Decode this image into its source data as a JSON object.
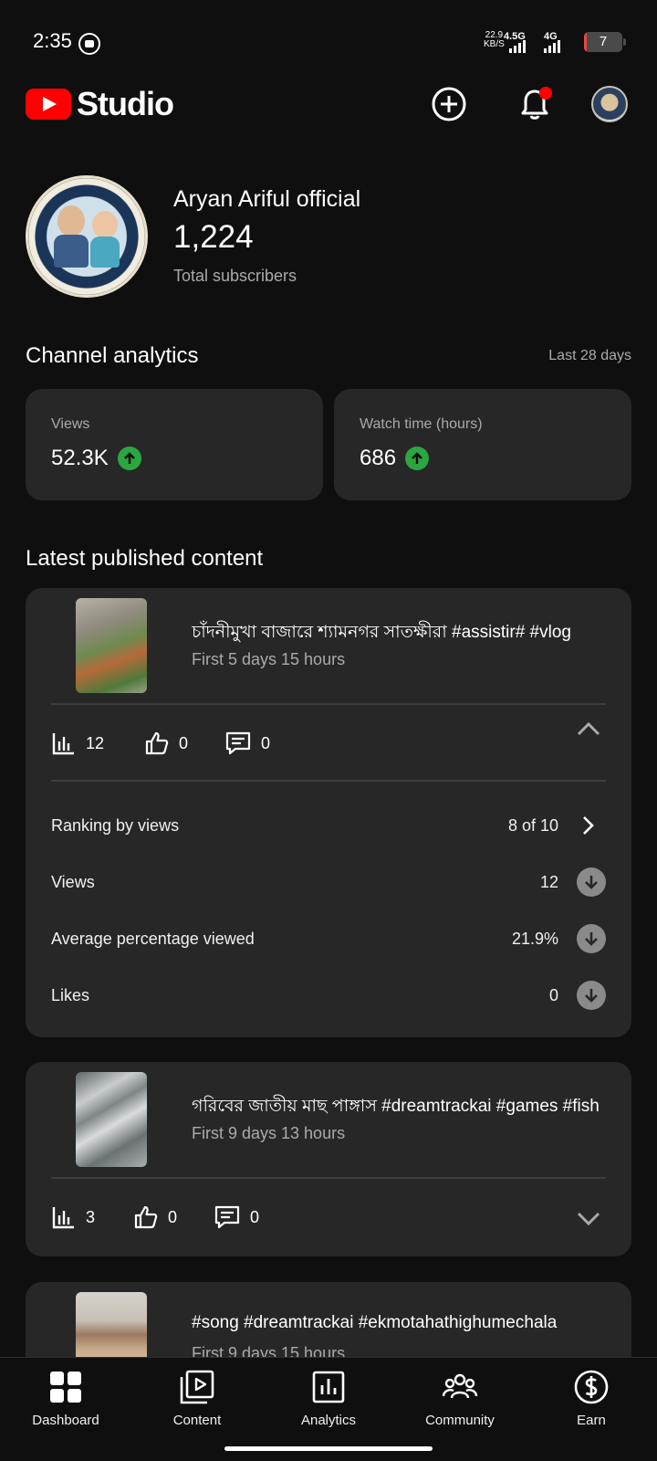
{
  "status_bar": {
    "time": "2:35",
    "net_speed_value": "22.9",
    "net_speed_unit": "KB/S",
    "signal1": "4.5G",
    "signal2": "4G",
    "battery": "7",
    "battery_level_pct": 7
  },
  "header": {
    "logo_text": "Studio",
    "brand_color": "#ff0000",
    "icons": [
      "create-icon",
      "notifications-icon",
      "account-avatar"
    ]
  },
  "channel": {
    "name": "Aryan Ariful official",
    "subscribers": "1,224",
    "subscribers_label": "Total subscribers"
  },
  "analytics": {
    "title": "Channel analytics",
    "range": "Last 28 days",
    "cards": [
      {
        "label": "Views",
        "value": "52.3K",
        "trend": "up"
      },
      {
        "label": "Watch time (hours)",
        "value": "686",
        "trend": "up"
      }
    ],
    "trend_color": "#2ba640"
  },
  "latest": {
    "title": "Latest published content",
    "items": [
      {
        "title": "চাঁদনীমুখা বাজারে শ্যামনগর সাতক্ষীরা #assistir# #vlog",
        "meta": "First 5 days 15 hours",
        "views": "12",
        "likes": "0",
        "comments": "0",
        "expanded": true,
        "details": [
          {
            "label": "Ranking by views",
            "value": "8 of 10",
            "icon": "chevron-right-icon"
          },
          {
            "label": "Views",
            "value": "12",
            "icon": "arrow-down-icon"
          },
          {
            "label": "Average percentage viewed",
            "value": "21.9%",
            "icon": "arrow-down-icon"
          },
          {
            "label": "Likes",
            "value": "0",
            "icon": "arrow-down-icon"
          }
        ]
      },
      {
        "title": "গরিবের জাতীয় মাছ পাঙ্গাস #dreamtrackai #games #fish",
        "meta": "First 9 days 13 hours",
        "views": "3",
        "likes": "0",
        "comments": "0",
        "expanded": false
      },
      {
        "title": "#song #dreamtrackai #ekmotahathighumechala",
        "meta": "First 9 days 15 hours"
      }
    ]
  },
  "bottom_nav": {
    "items": [
      {
        "label": "Dashboard",
        "icon": "dashboard-icon",
        "active": true
      },
      {
        "label": "Content",
        "icon": "content-icon",
        "active": false
      },
      {
        "label": "Analytics",
        "icon": "analytics-icon",
        "active": false
      },
      {
        "label": "Community",
        "icon": "community-icon",
        "active": false
      },
      {
        "label": "Earn",
        "icon": "earn-icon",
        "active": false
      }
    ]
  }
}
